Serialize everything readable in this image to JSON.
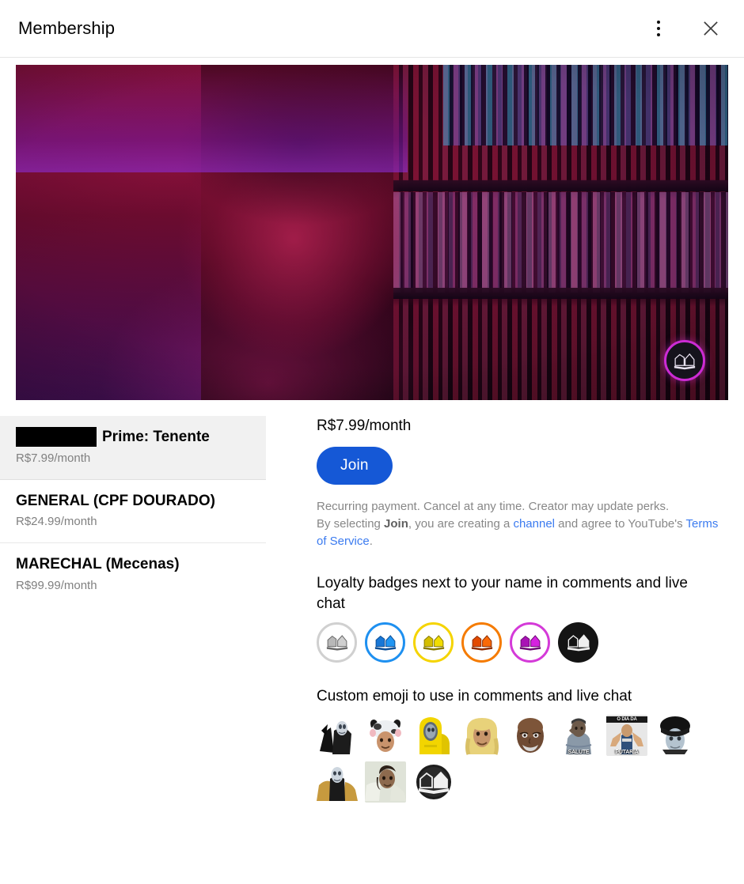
{
  "header": {
    "title": "Membership",
    "more_icon": "kebab-menu-icon",
    "close_icon": "close-icon"
  },
  "banner": {
    "avatar_icon": "channel-book-logo-icon",
    "avatar_ring_color": "#cc2bd4"
  },
  "tiers": [
    {
      "name_redacted": true,
      "name": "Prime: Tenente",
      "price": "R$7.99/month",
      "selected": true
    },
    {
      "name_redacted": false,
      "name": "GENERAL (CPF DOURADO)",
      "price": "R$24.99/month",
      "selected": false
    },
    {
      "name_redacted": false,
      "name": "MARECHAL (Mecenas)",
      "price": "R$99.99/month",
      "selected": false
    }
  ],
  "detail": {
    "price": "R$7.99/month",
    "join_label": "Join",
    "join_color": "#1558d6",
    "legal_line1": "Recurring payment. Cancel at any time. Creator may update perks.",
    "legal_prefix": "By selecting ",
    "legal_join_word": "Join",
    "legal_mid": ", you are creating a ",
    "legal_channel_link": "channel",
    "legal_mid2": " and agree to YouTube's ",
    "legal_tos_link": "Terms of Service",
    "legal_period": ".",
    "badges_title": "Loyalty badges next to your name in comments and live chat",
    "badges": [
      {
        "name": "loyalty-badge-gray",
        "ring": "#d0d0d0",
        "fill": "#b8b8b8",
        "style": "ring"
      },
      {
        "name": "loyalty-badge-blue",
        "ring": "#1e90f0",
        "fill": "#1e90f0",
        "style": "ring"
      },
      {
        "name": "loyalty-badge-yellow",
        "ring": "#f5d400",
        "fill": "#e8cc00",
        "style": "ring"
      },
      {
        "name": "loyalty-badge-orange",
        "ring": "#f57b00",
        "fill": "#f25c05",
        "style": "ring"
      },
      {
        "name": "loyalty-badge-magenta",
        "ring": "#d43ad8",
        "fill": "#d422d8",
        "style": "ring"
      },
      {
        "name": "loyalty-badge-black",
        "ring": "#141414",
        "fill": "#141414",
        "style": "filled"
      }
    ],
    "emoji_title": "Custom emoji to use in comments and live chat",
    "emoji": [
      {
        "name": "emoji-dark-armored-figure",
        "caption": "",
        "caption_top": ""
      },
      {
        "name": "emoji-cow-hat-face",
        "caption": "",
        "caption_top": ""
      },
      {
        "name": "emoji-yellow-hazmat-suit",
        "caption": "",
        "caption_top": ""
      },
      {
        "name": "emoji-blonde-hair-face",
        "caption": "",
        "caption_top": ""
      },
      {
        "name": "emoji-bald-man-face",
        "caption": "",
        "caption_top": ""
      },
      {
        "name": "emoji-saluting-figure",
        "caption": "SALUTE",
        "caption_top": ""
      },
      {
        "name": "emoji-putaria",
        "caption": "PUTARIA",
        "caption_top": "O DIA DA"
      },
      {
        "name": "emoji-fur-hat-face",
        "caption": "",
        "caption_top": ""
      },
      {
        "name": "emoji-gold-cloak-figure",
        "caption": "",
        "caption_top": ""
      },
      {
        "name": "emoji-person-light-coat",
        "caption": "",
        "caption_top": ""
      },
      {
        "name": "emoji-channel-book-logo",
        "caption": "",
        "caption_top": ""
      }
    ]
  }
}
